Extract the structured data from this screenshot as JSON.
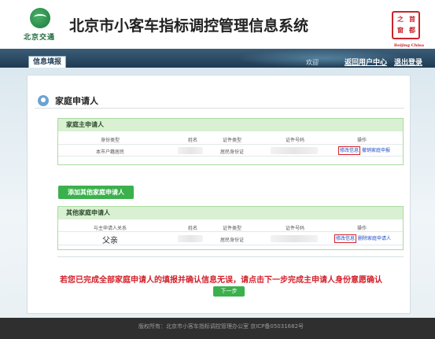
{
  "header": {
    "logo_text": "北京交通",
    "title": "北京市小客车指标调控管理信息系统",
    "seal": {
      "chars": [
        "首",
        "都",
        "之",
        "窗"
      ],
      "sub": "Beijing China"
    }
  },
  "nav": {
    "tab": "信息填报",
    "welcome": "欢迎",
    "user_center": "返回用户中心",
    "logout": "退出登录"
  },
  "section": {
    "title": "家庭申请人"
  },
  "main_applicant": {
    "heading": "家庭主申请人",
    "columns": [
      "身份类型",
      "姓名",
      "证件类型",
      "证件号码",
      "操作"
    ],
    "row": {
      "identity_type": "本市户籍居民",
      "id_type": "居民身份证",
      "actions": [
        "修改信息",
        "撤销家庭申报"
      ]
    }
  },
  "add_button": "添加其他家庭申请人",
  "other_applicants": {
    "heading": "其他家庭申请人",
    "columns": [
      "与主申请人关系",
      "姓名",
      "证件类型",
      "证件号码",
      "操作"
    ],
    "row": {
      "relation": "父亲",
      "id_type": "居民身份证",
      "actions": [
        "修改信息",
        "删除家庭申请人"
      ]
    }
  },
  "notice": "若您已完成全部家庭申请人的填报并确认信息无误，请点击下一步完成主申请人身份意愿确认",
  "next_button": "下一步",
  "footer": {
    "text": "版权所有：北京市小客车指标调控管理办公室    京ICP备05031682号"
  },
  "colors": {
    "accent_green": "#3bb04c",
    "nav_dark": "#1f3b52",
    "highlight_red": "#d3202a",
    "link_blue": "#1f4fc4"
  }
}
